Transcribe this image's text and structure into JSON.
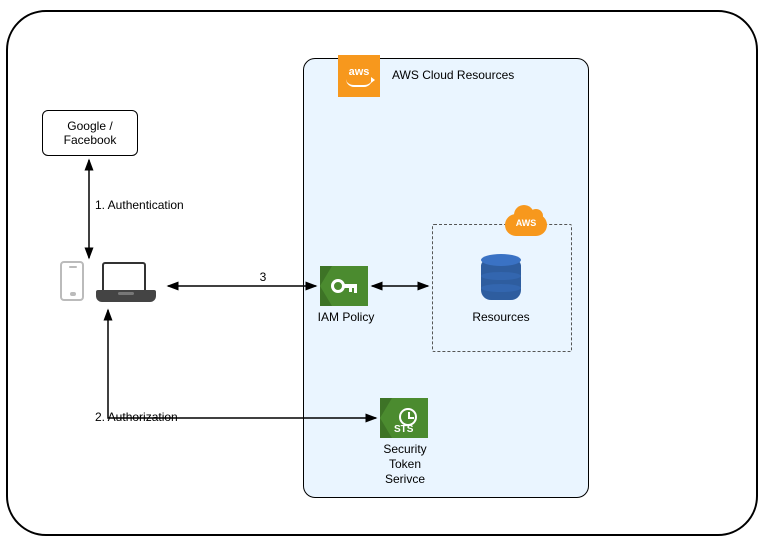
{
  "idp": {
    "label": "Google /\nFacebook"
  },
  "steps": {
    "auth_label": "1. Authentication",
    "authz_label": "2. Authorization",
    "access_label": "3"
  },
  "cloud": {
    "title": "AWS Cloud Resources",
    "logo_text": "aws",
    "iam_label": "IAM Policy",
    "sts_label": "Security\nToken\nSerivce",
    "sts_badge": "STS",
    "resources_label": "Resources",
    "resources_cloud_text": "AWS"
  },
  "icons": {
    "phone": "phone-icon",
    "laptop": "laptop-icon",
    "aws_logo": "aws-logo-icon",
    "aws_cloud": "aws-cloud-icon",
    "database": "database-icon",
    "key": "key-icon",
    "clock": "clock-icon"
  },
  "colors": {
    "aws_orange": "#f7981d",
    "iam_green": "#4b8b2f",
    "cloud_bg": "#eaf5ff",
    "db_blue": "#2e5d9f"
  }
}
